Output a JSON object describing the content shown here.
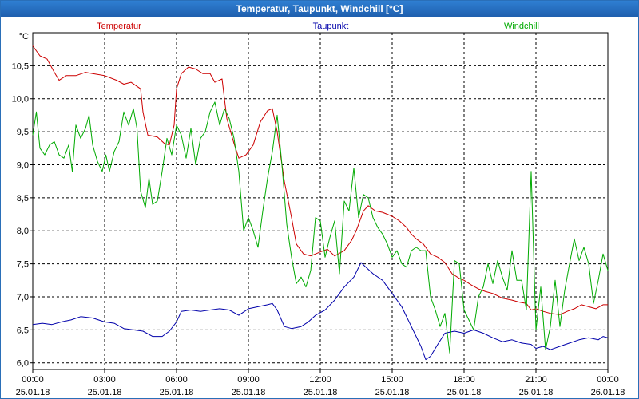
{
  "window": {
    "title": "Temperatur, Taupunkt, Windchill [°C]"
  },
  "chart_data": {
    "type": "line",
    "title": "Temperatur, Taupunkt, Windchill [°C]",
    "ylabel": "°C",
    "ylim": [
      5.9,
      11.0
    ],
    "xlim_hours": [
      0,
      24
    ],
    "grid": true,
    "legend_placement": "top",
    "y_ticks": [
      {
        "v": 6.0,
        "label": "6,0"
      },
      {
        "v": 6.5,
        "label": "6,5"
      },
      {
        "v": 7.0,
        "label": "7,0"
      },
      {
        "v": 7.5,
        "label": "7,5"
      },
      {
        "v": 8.0,
        "label": "8,0"
      },
      {
        "v": 8.5,
        "label": "8,5"
      },
      {
        "v": 9.0,
        "label": "9,0"
      },
      {
        "v": 9.5,
        "label": "9,5"
      },
      {
        "v": 10.0,
        "label": "10,0"
      },
      {
        "v": 10.5,
        "label": "10,5"
      }
    ],
    "x_ticks": [
      {
        "h": 0,
        "time": "00:00",
        "date": "25.01.18"
      },
      {
        "h": 3,
        "time": "03:00",
        "date": "25.01.18"
      },
      {
        "h": 6,
        "time": "06:00",
        "date": "25.01.18"
      },
      {
        "h": 9,
        "time": "09:00",
        "date": "25.01.18"
      },
      {
        "h": 12,
        "time": "12:00",
        "date": "25.01.18"
      },
      {
        "h": 15,
        "time": "15:00",
        "date": "25.01.18"
      },
      {
        "h": 18,
        "time": "18:00",
        "date": "25.01.18"
      },
      {
        "h": 21,
        "time": "21:00",
        "date": "25.01.18"
      },
      {
        "h": 24,
        "time": "00:00",
        "date": "26.01.18"
      }
    ],
    "series": [
      {
        "name": "Temperatur",
        "color": "#cc0000",
        "points": [
          [
            0,
            10.8
          ],
          [
            0.3,
            10.65
          ],
          [
            0.6,
            10.6
          ],
          [
            0.9,
            10.4
          ],
          [
            1.1,
            10.28
          ],
          [
            1.4,
            10.35
          ],
          [
            1.8,
            10.35
          ],
          [
            2.2,
            10.4
          ],
          [
            2.5,
            10.38
          ],
          [
            3.0,
            10.35
          ],
          [
            3.5,
            10.28
          ],
          [
            3.8,
            10.22
          ],
          [
            4.1,
            10.25
          ],
          [
            4.5,
            10.15
          ],
          [
            4.6,
            9.8
          ],
          [
            4.8,
            9.45
          ],
          [
            5.2,
            9.42
          ],
          [
            5.5,
            9.32
          ],
          [
            5.7,
            9.3
          ],
          [
            5.9,
            9.6
          ],
          [
            6.0,
            10.15
          ],
          [
            6.2,
            10.38
          ],
          [
            6.5,
            10.48
          ],
          [
            6.8,
            10.45
          ],
          [
            7.1,
            10.38
          ],
          [
            7.4,
            10.38
          ],
          [
            7.6,
            10.25
          ],
          [
            7.9,
            10.3
          ],
          [
            8.1,
            9.7
          ],
          [
            8.4,
            9.32
          ],
          [
            8.6,
            9.1
          ],
          [
            8.9,
            9.15
          ],
          [
            9.2,
            9.3
          ],
          [
            9.5,
            9.65
          ],
          [
            9.8,
            9.82
          ],
          [
            10.0,
            9.85
          ],
          [
            10.2,
            9.5
          ],
          [
            10.5,
            8.75
          ],
          [
            10.8,
            8.2
          ],
          [
            11.0,
            7.8
          ],
          [
            11.3,
            7.65
          ],
          [
            11.6,
            7.62
          ],
          [
            12.0,
            7.68
          ],
          [
            12.3,
            7.72
          ],
          [
            12.6,
            7.62
          ],
          [
            13.0,
            7.7
          ],
          [
            13.3,
            7.85
          ],
          [
            13.5,
            8.0
          ],
          [
            13.8,
            8.3
          ],
          [
            14.0,
            8.38
          ],
          [
            14.3,
            8.3
          ],
          [
            14.6,
            8.28
          ],
          [
            15.0,
            8.22
          ],
          [
            15.3,
            8.15
          ],
          [
            15.6,
            8.05
          ],
          [
            15.8,
            7.95
          ],
          [
            16.0,
            7.88
          ],
          [
            16.3,
            7.8
          ],
          [
            16.6,
            7.65
          ],
          [
            16.9,
            7.6
          ],
          [
            17.2,
            7.52
          ],
          [
            17.5,
            7.35
          ],
          [
            17.8,
            7.28
          ],
          [
            18.0,
            7.25
          ],
          [
            18.3,
            7.18
          ],
          [
            18.6,
            7.12
          ],
          [
            18.9,
            7.08
          ],
          [
            19.2,
            7.05
          ],
          [
            19.6,
            6.98
          ],
          [
            20.0,
            6.95
          ],
          [
            20.3,
            6.92
          ],
          [
            20.6,
            6.9
          ],
          [
            20.8,
            6.8
          ],
          [
            21.0,
            6.82
          ],
          [
            21.3,
            6.78
          ],
          [
            21.6,
            6.75
          ],
          [
            22.0,
            6.73
          ],
          [
            22.3,
            6.78
          ],
          [
            22.6,
            6.82
          ],
          [
            22.9,
            6.88
          ],
          [
            23.2,
            6.85
          ],
          [
            23.5,
            6.82
          ],
          [
            23.8,
            6.88
          ],
          [
            24.0,
            6.88
          ]
        ]
      },
      {
        "name": "Taupunkt",
        "color": "#0000aa",
        "points": [
          [
            0,
            6.58
          ],
          [
            0.4,
            6.6
          ],
          [
            0.8,
            6.58
          ],
          [
            1.2,
            6.62
          ],
          [
            1.6,
            6.65
          ],
          [
            2.0,
            6.7
          ],
          [
            2.5,
            6.68
          ],
          [
            3.0,
            6.62
          ],
          [
            3.4,
            6.6
          ],
          [
            3.8,
            6.52
          ],
          [
            4.2,
            6.5
          ],
          [
            4.6,
            6.48
          ],
          [
            5.0,
            6.4
          ],
          [
            5.4,
            6.4
          ],
          [
            5.7,
            6.48
          ],
          [
            6.0,
            6.62
          ],
          [
            6.2,
            6.78
          ],
          [
            6.6,
            6.8
          ],
          [
            7.0,
            6.78
          ],
          [
            7.4,
            6.8
          ],
          [
            7.8,
            6.82
          ],
          [
            8.2,
            6.8
          ],
          [
            8.6,
            6.72
          ],
          [
            9.0,
            6.82
          ],
          [
            9.4,
            6.85
          ],
          [
            9.8,
            6.88
          ],
          [
            10.0,
            6.9
          ],
          [
            10.2,
            6.8
          ],
          [
            10.5,
            6.55
          ],
          [
            10.8,
            6.52
          ],
          [
            11.2,
            6.55
          ],
          [
            11.5,
            6.62
          ],
          [
            11.8,
            6.72
          ],
          [
            12.2,
            6.8
          ],
          [
            12.6,
            6.95
          ],
          [
            13.0,
            7.15
          ],
          [
            13.4,
            7.3
          ],
          [
            13.7,
            7.52
          ],
          [
            13.9,
            7.45
          ],
          [
            14.2,
            7.35
          ],
          [
            14.6,
            7.25
          ],
          [
            15.0,
            7.05
          ],
          [
            15.4,
            6.85
          ],
          [
            15.8,
            6.55
          ],
          [
            16.2,
            6.25
          ],
          [
            16.4,
            6.05
          ],
          [
            16.6,
            6.1
          ],
          [
            16.9,
            6.28
          ],
          [
            17.2,
            6.45
          ],
          [
            17.6,
            6.48
          ],
          [
            18.0,
            6.45
          ],
          [
            18.4,
            6.5
          ],
          [
            18.8,
            6.45
          ],
          [
            19.2,
            6.38
          ],
          [
            19.6,
            6.32
          ],
          [
            20.0,
            6.35
          ],
          [
            20.4,
            6.3
          ],
          [
            20.8,
            6.28
          ],
          [
            21.0,
            6.22
          ],
          [
            21.3,
            6.25
          ],
          [
            21.6,
            6.2
          ],
          [
            22.0,
            6.25
          ],
          [
            22.4,
            6.3
          ],
          [
            22.8,
            6.35
          ],
          [
            23.2,
            6.38
          ],
          [
            23.6,
            6.35
          ],
          [
            23.8,
            6.4
          ],
          [
            24.0,
            6.38
          ]
        ]
      },
      {
        "name": "Windchill",
        "color": "#00aa00",
        "points": [
          [
            0,
            9.45
          ],
          [
            0.15,
            9.8
          ],
          [
            0.3,
            9.25
          ],
          [
            0.5,
            9.15
          ],
          [
            0.7,
            9.3
          ],
          [
            0.9,
            9.35
          ],
          [
            1.1,
            9.15
          ],
          [
            1.3,
            9.1
          ],
          [
            1.5,
            9.3
          ],
          [
            1.65,
            8.9
          ],
          [
            1.8,
            9.6
          ],
          [
            2.0,
            9.4
          ],
          [
            2.2,
            9.55
          ],
          [
            2.35,
            9.75
          ],
          [
            2.5,
            9.3
          ],
          [
            2.7,
            9.05
          ],
          [
            2.9,
            8.9
          ],
          [
            3.05,
            9.15
          ],
          [
            3.2,
            8.9
          ],
          [
            3.4,
            9.2
          ],
          [
            3.6,
            9.35
          ],
          [
            3.8,
            9.8
          ],
          [
            4.0,
            9.6
          ],
          [
            4.2,
            9.85
          ],
          [
            4.35,
            9.55
          ],
          [
            4.5,
            8.6
          ],
          [
            4.7,
            8.35
          ],
          [
            4.85,
            8.8
          ],
          [
            5.0,
            8.4
          ],
          [
            5.2,
            8.45
          ],
          [
            5.4,
            8.9
          ],
          [
            5.6,
            9.4
          ],
          [
            5.8,
            9.15
          ],
          [
            6.0,
            9.6
          ],
          [
            6.2,
            9.45
          ],
          [
            6.4,
            9.1
          ],
          [
            6.6,
            9.55
          ],
          [
            6.8,
            9.0
          ],
          [
            7.0,
            9.4
          ],
          [
            7.2,
            9.5
          ],
          [
            7.4,
            9.8
          ],
          [
            7.6,
            9.95
          ],
          [
            7.8,
            9.6
          ],
          [
            8.0,
            9.85
          ],
          [
            8.2,
            9.7
          ],
          [
            8.4,
            9.4
          ],
          [
            8.6,
            8.9
          ],
          [
            8.8,
            8.0
          ],
          [
            9.0,
            8.2
          ],
          [
            9.2,
            8.0
          ],
          [
            9.4,
            7.75
          ],
          [
            9.6,
            8.3
          ],
          [
            9.8,
            8.8
          ],
          [
            10.0,
            9.2
          ],
          [
            10.2,
            9.75
          ],
          [
            10.4,
            9.0
          ],
          [
            10.6,
            8.1
          ],
          [
            10.8,
            7.6
          ],
          [
            11.0,
            7.2
          ],
          [
            11.2,
            7.3
          ],
          [
            11.4,
            7.15
          ],
          [
            11.6,
            7.4
          ],
          [
            11.8,
            8.2
          ],
          [
            12.0,
            8.15
          ],
          [
            12.2,
            7.6
          ],
          [
            12.4,
            7.9
          ],
          [
            12.6,
            8.15
          ],
          [
            12.8,
            7.35
          ],
          [
            13.0,
            8.45
          ],
          [
            13.2,
            8.3
          ],
          [
            13.4,
            8.95
          ],
          [
            13.6,
            8.2
          ],
          [
            13.8,
            8.55
          ],
          [
            14.0,
            8.5
          ],
          [
            14.2,
            8.2
          ],
          [
            14.4,
            8.05
          ],
          [
            14.6,
            7.95
          ],
          [
            14.8,
            7.8
          ],
          [
            15.0,
            7.6
          ],
          [
            15.2,
            7.7
          ],
          [
            15.4,
            7.5
          ],
          [
            15.6,
            7.45
          ],
          [
            15.8,
            7.7
          ],
          [
            16.0,
            7.75
          ],
          [
            16.2,
            7.7
          ],
          [
            16.4,
            7.7
          ],
          [
            16.6,
            7.0
          ],
          [
            16.8,
            6.8
          ],
          [
            17.0,
            6.55
          ],
          [
            17.2,
            6.75
          ],
          [
            17.4,
            6.15
          ],
          [
            17.6,
            7.55
          ],
          [
            17.8,
            7.5
          ],
          [
            18.0,
            6.8
          ],
          [
            18.2,
            6.65
          ],
          [
            18.4,
            6.5
          ],
          [
            18.6,
            7.0
          ],
          [
            18.8,
            7.15
          ],
          [
            19.0,
            7.5
          ],
          [
            19.2,
            7.2
          ],
          [
            19.4,
            7.55
          ],
          [
            19.6,
            7.3
          ],
          [
            19.8,
            7.1
          ],
          [
            20.0,
            7.7
          ],
          [
            20.2,
            7.25
          ],
          [
            20.4,
            7.25
          ],
          [
            20.6,
            6.8
          ],
          [
            20.8,
            8.9
          ],
          [
            21.0,
            6.5
          ],
          [
            21.2,
            7.15
          ],
          [
            21.4,
            6.2
          ],
          [
            21.6,
            6.55
          ],
          [
            21.8,
            7.25
          ],
          [
            22.0,
            6.55
          ],
          [
            22.2,
            7.1
          ],
          [
            22.4,
            7.5
          ],
          [
            22.6,
            7.88
          ],
          [
            22.8,
            7.55
          ],
          [
            23.0,
            7.75
          ],
          [
            23.2,
            7.5
          ],
          [
            23.4,
            6.9
          ],
          [
            23.6,
            7.25
          ],
          [
            23.8,
            7.65
          ],
          [
            24.0,
            7.4
          ]
        ]
      }
    ]
  }
}
